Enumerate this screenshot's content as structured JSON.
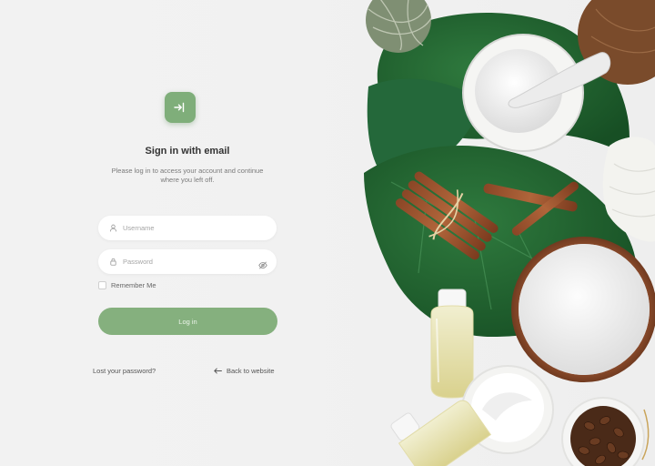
{
  "login": {
    "title": "Sign in with email",
    "subtitle_line1": "Please log in to access your account and continue",
    "subtitle_line2": "where you left off.",
    "username_placeholder": "Username",
    "password_placeholder": "Password",
    "remember_label": "Remember Me",
    "login_button": "Log in",
    "lost_password": "Lost your password?",
    "back_to_website": "Back to website"
  },
  "icons": {
    "logo": "sign-in-icon",
    "username": "user-icon",
    "password": "lock-icon",
    "toggle_visibility": "eye-off-icon",
    "back": "arrow-left-icon"
  },
  "colors": {
    "accent": "#85b07e",
    "logo_bg": "#7fae7a",
    "background": "#f1f1f1"
  }
}
